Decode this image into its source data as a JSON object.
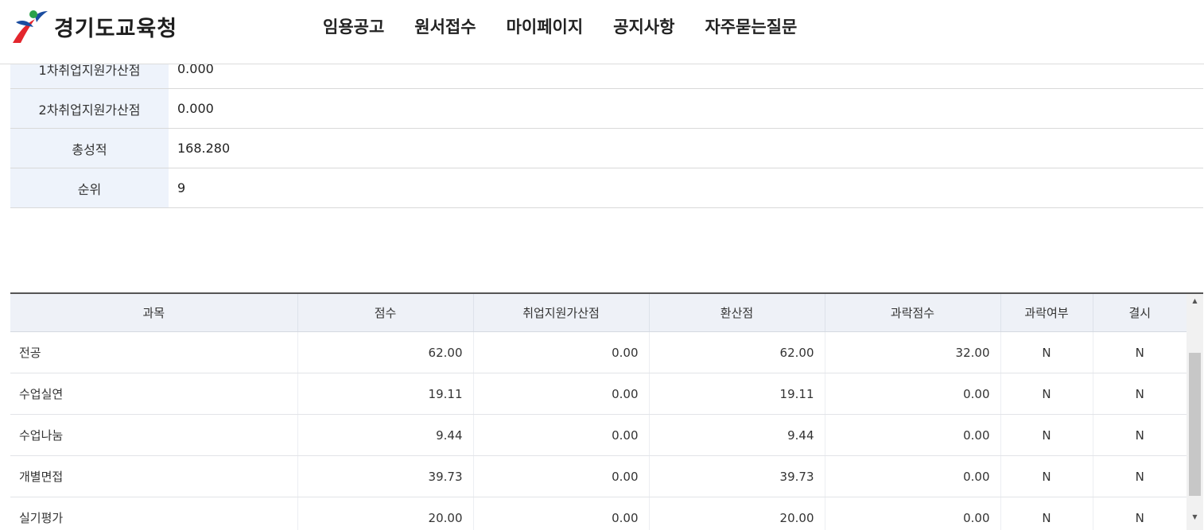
{
  "header": {
    "logo_text": "경기도교육청",
    "nav": [
      "임용공고",
      "원서접수",
      "마이페이지",
      "공지사항",
      "자주묻는질문"
    ]
  },
  "summary": [
    {
      "label": "1차취업지원가산점",
      "value": "0.000"
    },
    {
      "label": "2차취업지원가산점",
      "value": "0.000"
    },
    {
      "label": "총성적",
      "value": "168.280"
    },
    {
      "label": "순위",
      "value": "9"
    }
  ],
  "grid": {
    "headers": [
      "과목",
      "점수",
      "취업지원가산점",
      "환산점",
      "과락점수",
      "과락여부",
      "결시"
    ],
    "rows": [
      [
        "전공",
        "62.00",
        "0.00",
        "62.00",
        "32.00",
        "N",
        "N"
      ],
      [
        "수업실연",
        "19.11",
        "0.00",
        "19.11",
        "0.00",
        "N",
        "N"
      ],
      [
        "수업나눔",
        "9.44",
        "0.00",
        "9.44",
        "0.00",
        "N",
        "N"
      ],
      [
        "개별면접",
        "39.73",
        "0.00",
        "39.73",
        "0.00",
        "N",
        "N"
      ],
      [
        "실기평가",
        "20.00",
        "0.00",
        "20.00",
        "0.00",
        "N",
        "N"
      ]
    ]
  },
  "colors": {
    "brand_red": "#e3262d",
    "brand_blue": "#1b4da0",
    "header_bg": "#eef1f7"
  }
}
